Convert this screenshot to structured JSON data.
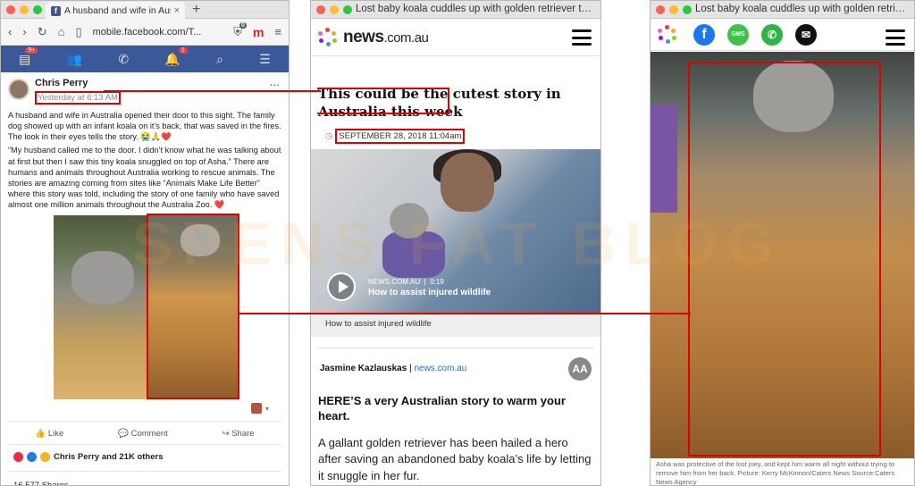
{
  "facebook": {
    "tab_title": "A husband and wife in Australia op",
    "tab_close": "×",
    "new_tab": "+",
    "url": "mobile.facebook.com/T...",
    "notif_badge_1": "9+",
    "notif_badge_2": "1",
    "ext_badge": "0",
    "author": "Chris Perry",
    "timestamp": "Yesterday at 6:13 AM",
    "more": "...",
    "paragraph1": "A husband and wife in Australia opened their door to this sight. The family dog showed up with an infant koala on it's back, that was saved in the fires. The look in their eyes tells the story. 😭🙏❤️",
    "paragraph2": "“My husband called me to the door. I didn’t know what he was talking about at first but then I saw this tiny koala snuggled on top of Asha.” There are humans and animals throughout Australia working to rescue animals. The stories are amazing coming from sites like “Animals Make Life Better” where this story was told, including the story of one family who have saved almost one million animals throughout the Australia Zoo. ❤️",
    "actions": {
      "like": "Like",
      "comment": "Comment",
      "share": "Share"
    },
    "reactions_text": "Chris Perry and 21K others",
    "shares": "16,577 Shares"
  },
  "news": {
    "window_title": "Lost baby koala cuddles up with golden retriever to sta...",
    "logo_main": "news",
    "logo_suffix": ".com.au",
    "headline": "This could be the cutest story in Australia this week",
    "date": "SEPTEMBER 28, 2018 11:04am",
    "video_source": "NEWS.COM.AU",
    "video_duration": "0:19",
    "video_title": "How to assist injured wildlife",
    "video_caption": "How to assist injured wildlife",
    "author": "Jasmine Kazlauskas",
    "author_sep": " | ",
    "author_source": "news.com.au",
    "text_size_button": "AA",
    "intro": "HERE’S a very Australian story to warm your heart.",
    "body": "A gallant golden retriever has been hailed a hero after saving an abandoned baby koala’s life by letting it snuggle in her fur."
  },
  "share": {
    "window_title": "Lost baby koala cuddles up with golden retriever to sta...",
    "facebook_label": "f",
    "sms_label": "SMS",
    "whatsapp_label": "✆",
    "email_label": "✉",
    "caption": "Asha was protective of the lost joey, and kept him warm all night without trying to remove him from her back. Picture: Kerry McKinnon/Caters News  Source:Caters News Agency"
  },
  "watermark": "SPENS  FAT  BLOG",
  "colors": {
    "highlight": "#e10000",
    "facebook_blue": "#3b5998",
    "news_link": "#1a6fc4"
  }
}
